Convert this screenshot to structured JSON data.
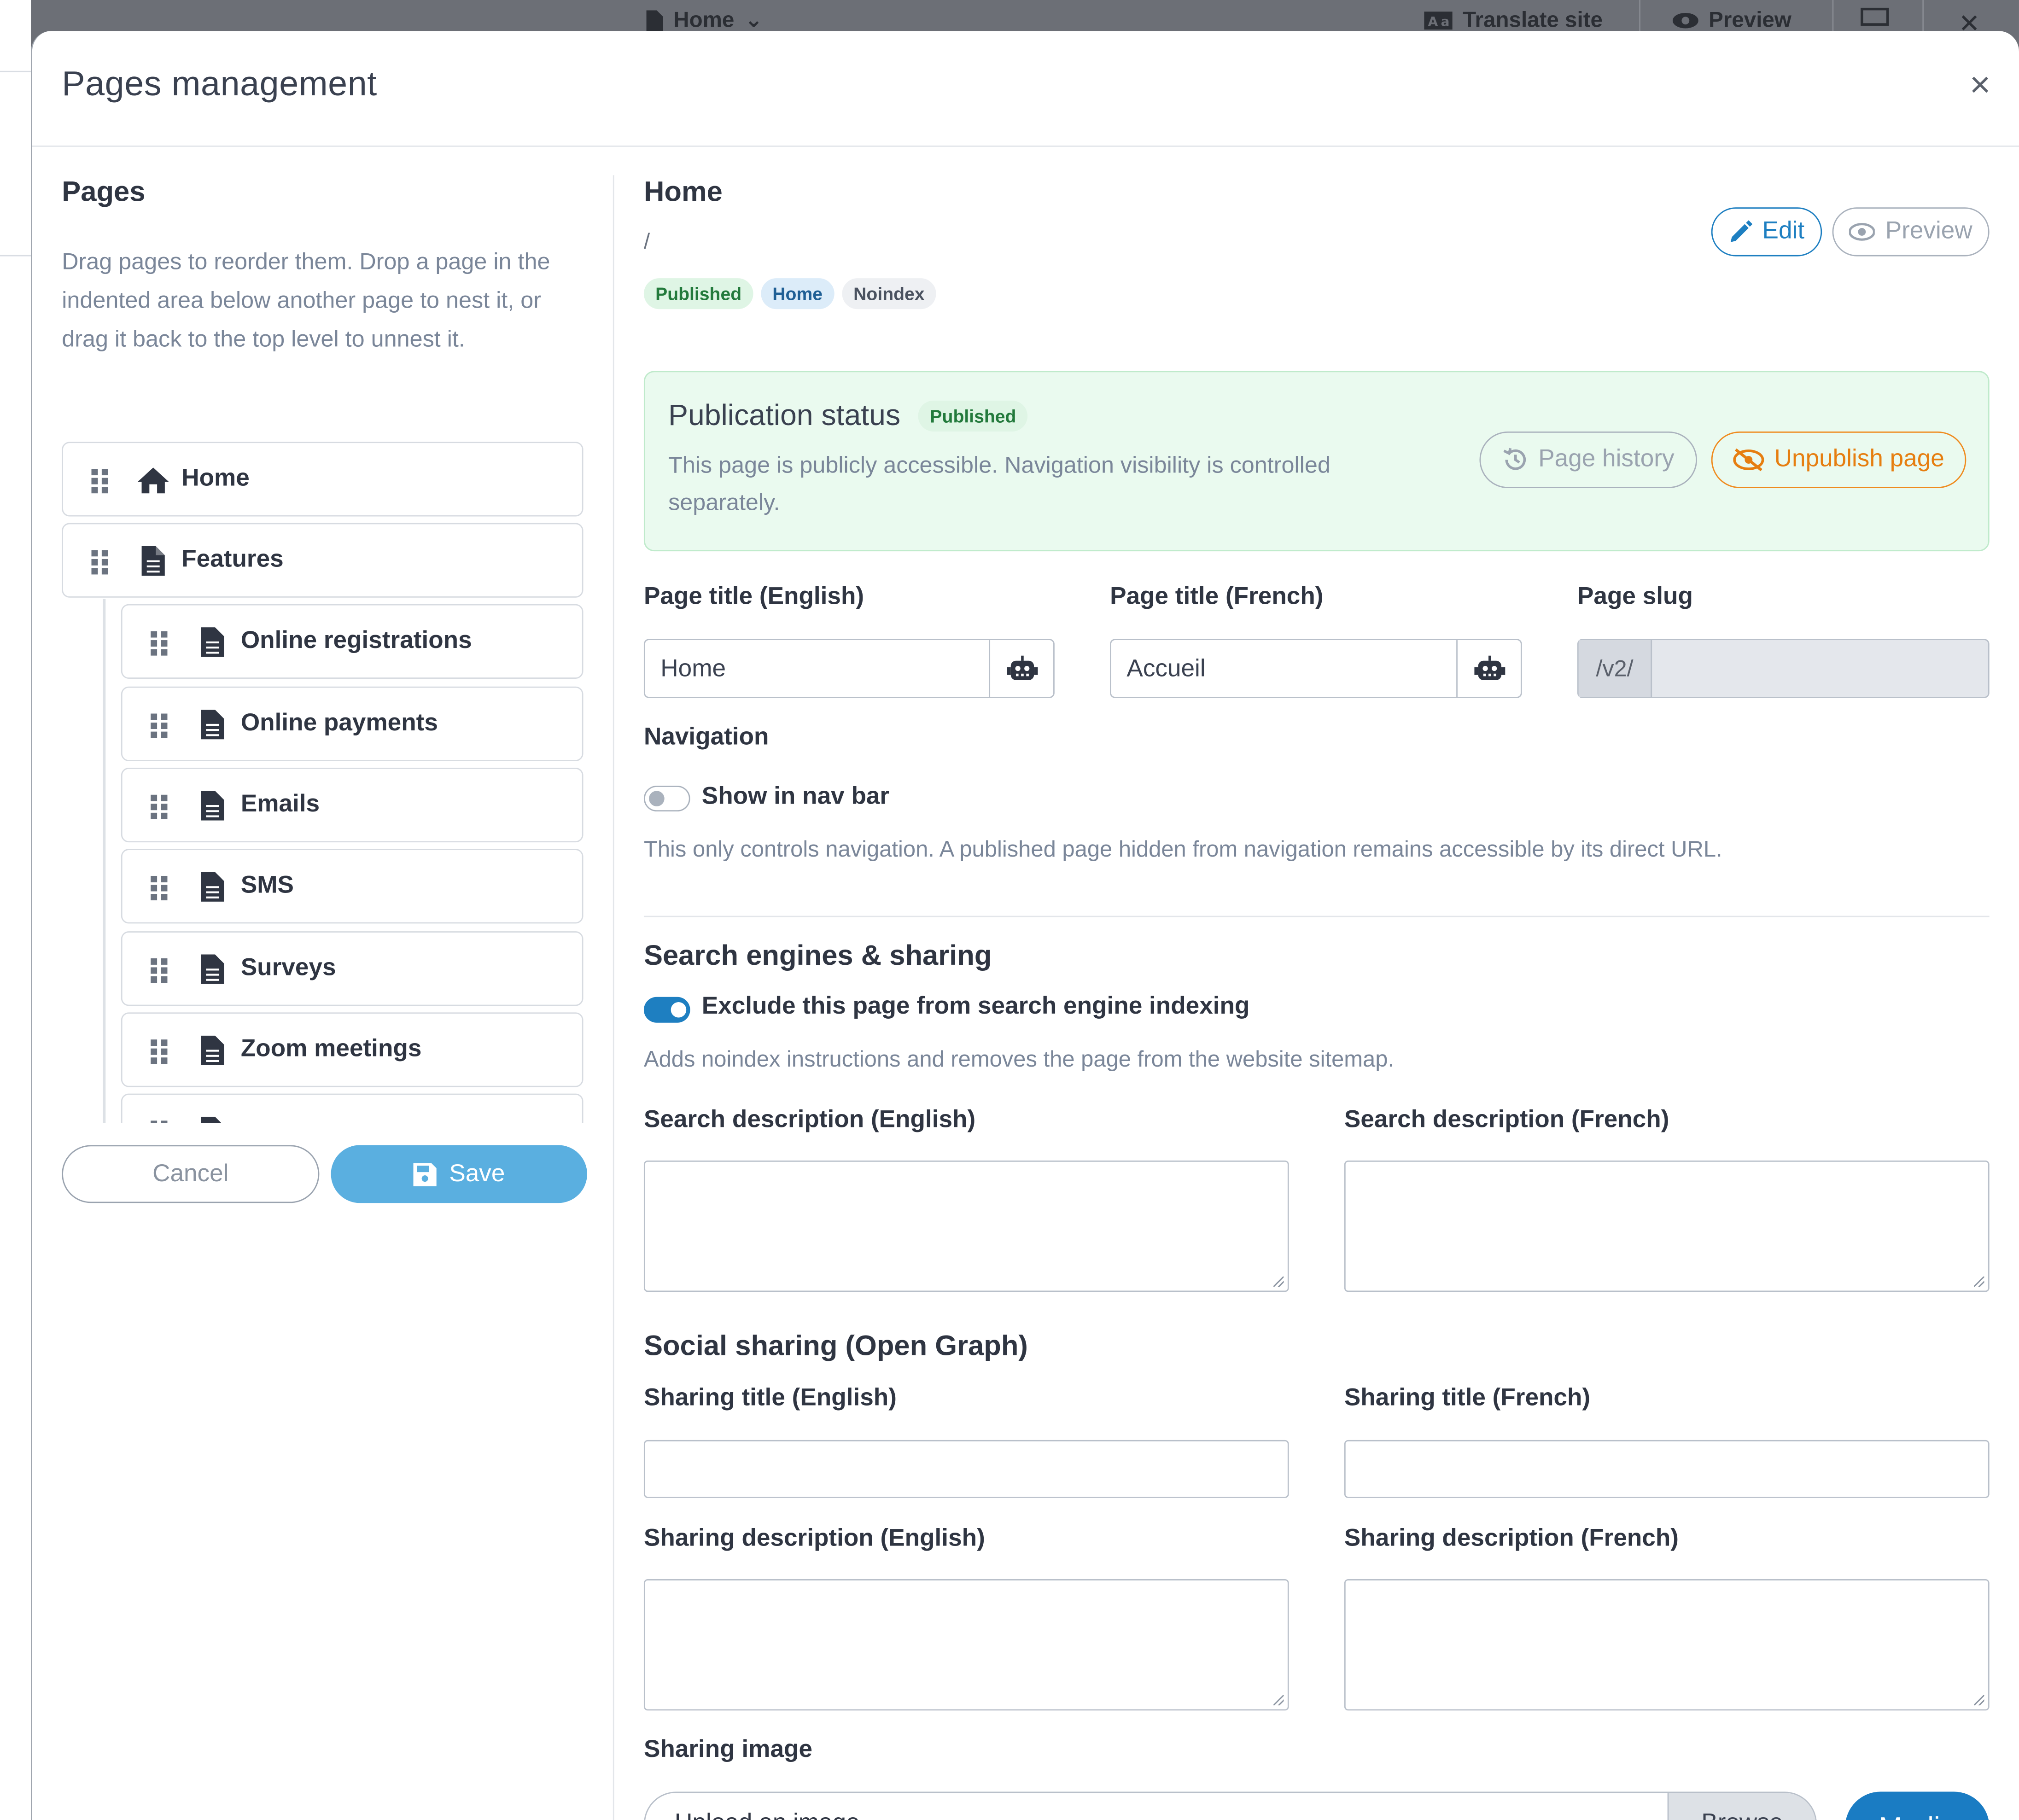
{
  "topbar": {
    "home_label": "Home",
    "translate_label": "Translate site",
    "preview_label": "Preview"
  },
  "modal": {
    "title": "Pages management",
    "close_label": "×"
  },
  "pages_panel": {
    "title": "Pages",
    "help": "Drag pages to reorder them. Drop a page in the indented area below another page to nest it, or drag it back to the top level to unnest it.",
    "items": [
      {
        "label": "Home",
        "icon": "home-icon"
      },
      {
        "label": "Features",
        "icon": "file-icon"
      },
      {
        "label": "Online registrations",
        "icon": "file-icon"
      },
      {
        "label": "Online payments",
        "icon": "file-icon"
      },
      {
        "label": "Emails",
        "icon": "file-icon"
      },
      {
        "label": "SMS",
        "icon": "file-icon"
      },
      {
        "label": "Surveys",
        "icon": "file-icon"
      },
      {
        "label": "Zoom meetings",
        "icon": "file-icon"
      }
    ],
    "cancel_label": "Cancel",
    "save_label": "Save"
  },
  "detail": {
    "title": "Home",
    "path": "/",
    "badges": {
      "published": "Published",
      "home": "Home",
      "noindex": "Noindex"
    },
    "edit_label": "Edit",
    "preview_label": "Preview",
    "publication": {
      "title": "Publication status",
      "badge": "Published",
      "text": "This page is publicly accessible. Navigation visibility is controlled separately.",
      "history_label": "Page history",
      "unpublish_label": "Unpublish page"
    },
    "fields": {
      "title_en_label": "Page title (English)",
      "title_en_value": "Home",
      "title_fr_label": "Page title (French)",
      "title_fr_value": "Accueil",
      "slug_label": "Page slug",
      "slug_prefix": "/v2/",
      "slug_value": ""
    },
    "navigation": {
      "label": "Navigation",
      "toggle_label": "Show in nav bar",
      "toggle_on": false,
      "hint": "This only controls navigation. A published page hidden from navigation remains accessible by its direct URL."
    },
    "seo": {
      "section_title": "Search engines & sharing",
      "noindex_label": "Exclude this page from search engine indexing",
      "noindex_on": true,
      "noindex_hint": "Adds noindex instructions and removes the page from the website sitemap.",
      "desc_en_label": "Search description (English)",
      "desc_fr_label": "Search description (French)"
    },
    "social": {
      "section_title": "Social sharing (Open Graph)",
      "title_en_label": "Sharing title (English)",
      "title_fr_label": "Sharing title (French)",
      "desc_en_label": "Sharing description (English)",
      "desc_fr_label": "Sharing description (French)",
      "image_label": "Sharing image",
      "upload_placeholder": "Upload an image",
      "browse_label": "Browse",
      "media_label": "Media"
    }
  },
  "colors": {
    "primary": "#1e7fc1",
    "save": "#5aafe0",
    "warning": "#e67e10",
    "success_bg": "#eafaef"
  }
}
